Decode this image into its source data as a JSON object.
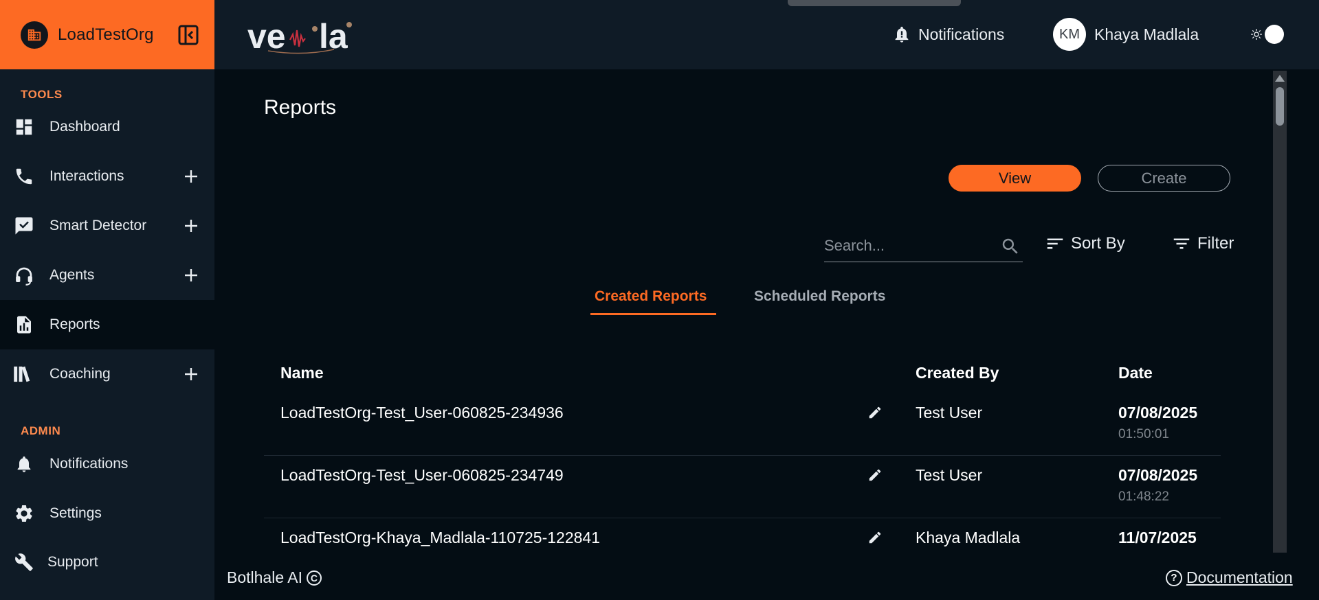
{
  "org": {
    "name": "LoadTestOrg"
  },
  "sidebar": {
    "tools_title": "TOOLS",
    "admin_title": "ADMIN",
    "items": [
      {
        "label": "Dashboard",
        "icon": "dashboard-icon"
      },
      {
        "label": "Interactions",
        "icon": "phone-icon"
      },
      {
        "label": "Smart Detector",
        "icon": "check-chat-icon"
      },
      {
        "label": "Agents",
        "icon": "headset-icon"
      },
      {
        "label": "Reports",
        "icon": "report-icon"
      },
      {
        "label": "Coaching",
        "icon": "books-icon"
      }
    ],
    "admin_items": [
      {
        "label": "Notifications",
        "icon": "bell-icon"
      },
      {
        "label": "Settings",
        "icon": "gear-icon"
      },
      {
        "label": "Support",
        "icon": "wrench-icon"
      }
    ]
  },
  "header": {
    "notifications_label": "Notifications",
    "user_initials": "KM",
    "user_name": "Khaya Madlala"
  },
  "page": {
    "title": "Reports"
  },
  "actions": {
    "view_label": "View",
    "create_label": "Create"
  },
  "search": {
    "placeholder": "Search...",
    "value": ""
  },
  "toolbar": {
    "sort_label": "Sort By",
    "filter_label": "Filter"
  },
  "tabs": [
    {
      "label": "Created Reports",
      "active": true
    },
    {
      "label": "Scheduled Reports",
      "active": false
    }
  ],
  "table": {
    "columns": [
      "Name",
      "Created By",
      "Date"
    ],
    "rows": [
      {
        "name": "LoadTestOrg-Test_User-060825-234936",
        "created_by": "Test User",
        "date": "07/08/2025",
        "time": "01:50:01"
      },
      {
        "name": "LoadTestOrg-Test_User-060825-234749",
        "created_by": "Test User",
        "date": "07/08/2025",
        "time": "01:48:22"
      },
      {
        "name": "LoadTestOrg-Khaya_Madlala-110725-122841",
        "created_by": "Khaya Madlala",
        "date": "11/07/2025",
        "time": ""
      }
    ]
  },
  "footer": {
    "copyright": "Botlhale AI",
    "docs_label": "Documentation"
  },
  "colors": {
    "accent": "#fd6a23",
    "sidebar_bg": "#0f1b26",
    "main_bg": "#040d14"
  }
}
